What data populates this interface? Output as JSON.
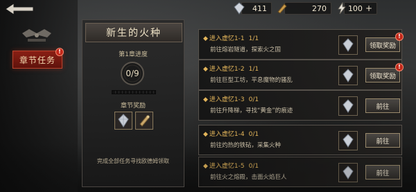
{
  "currencies": [
    {
      "icon": "crystal-icon",
      "value": "411"
    },
    {
      "icon": "gold-scroll-icon",
      "value": "270"
    },
    {
      "icon": "energy-bolt-icon",
      "value": "100",
      "plus": "+"
    }
  ],
  "sidebar": {
    "back_icon": "back-arrow-icon",
    "emblem_icon": "crest-emblem-icon",
    "chapter_tab_label": "章节任务",
    "chapter_tab_badge": "!"
  },
  "chapter": {
    "title": "新生的火种",
    "progress_label": "第1章进度",
    "progress_text": "0/9",
    "progress": 0,
    "reward_label": "章节奖励",
    "rewards": [
      "crystal-icon",
      "scroll-icon"
    ],
    "hint": "完成全部任务寻找欧德姆领取"
  },
  "tasks": [
    {
      "title": "进入虚忆1-1",
      "count": "1/1",
      "desc": "前往熔岩隧道，探索火之国",
      "button": "领取奖励",
      "badge": "!"
    },
    {
      "title": "进入虚忆1-2",
      "count": "1/1",
      "desc": "前往巨型工坊，平息魔物的骚乱",
      "button": "领取奖励",
      "badge": "!"
    },
    {
      "title": "进入虚忆1-3",
      "count": "0/1",
      "desc": "前往升降梯，寻找“黄金”的痕迹",
      "button": "前往",
      "badge": ""
    },
    {
      "title": "进入虚忆1-4",
      "count": "0/1",
      "desc": "前往灼热的铁砧，采集火种",
      "button": "前往",
      "badge": ""
    },
    {
      "title": "进入虚忆1-5",
      "count": "0/1",
      "desc": "前往火之熔殿，击面火焰巨人",
      "button": "前往",
      "badge": ""
    }
  ],
  "colors": {
    "accent_red": "#8a1f14",
    "title_gold": "#e2b45a"
  }
}
